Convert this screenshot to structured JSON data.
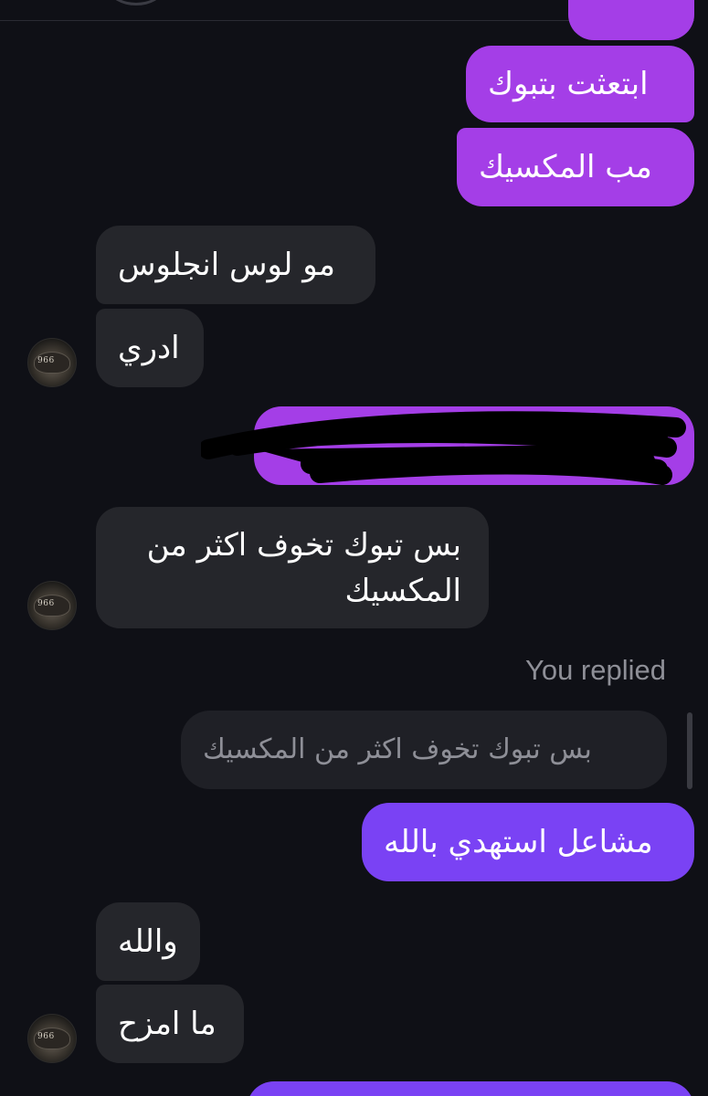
{
  "thread": {
    "messages": [
      {
        "id": "m1",
        "direction": "outgoing",
        "text": "ابتعثت بتبوك"
      },
      {
        "id": "m2",
        "direction": "outgoing",
        "text": "مب المكسيك"
      },
      {
        "id": "m3",
        "direction": "incoming",
        "text": "مو لوس انجلوس"
      },
      {
        "id": "m4",
        "direction": "incoming",
        "text": "ادري"
      },
      {
        "id": "m5",
        "direction": "outgoing",
        "text": "",
        "redacted": true
      },
      {
        "id": "m6",
        "direction": "incoming",
        "text": "بس تبوك تخوف اكثر من المكسيك"
      },
      {
        "id": "m7",
        "direction": "outgoing",
        "reply_label": "You replied",
        "quoted_text": "بس تبوك تخوف اكثر من المكسيك",
        "text": "مشاعل استهدي بالله"
      },
      {
        "id": "m8",
        "direction": "incoming",
        "text": "والله"
      },
      {
        "id": "m9",
        "direction": "incoming",
        "text": "ما امزح"
      }
    ]
  },
  "avatar": {
    "cap_text": "966"
  },
  "colors": {
    "background": "#0f1016",
    "incoming_bubble": "#25262b",
    "outgoing_pink": "#a43ee7",
    "outgoing_violet": "#7a42f4",
    "reply_quote_bg": "#1f2026",
    "muted_text": "#8e8f97"
  }
}
